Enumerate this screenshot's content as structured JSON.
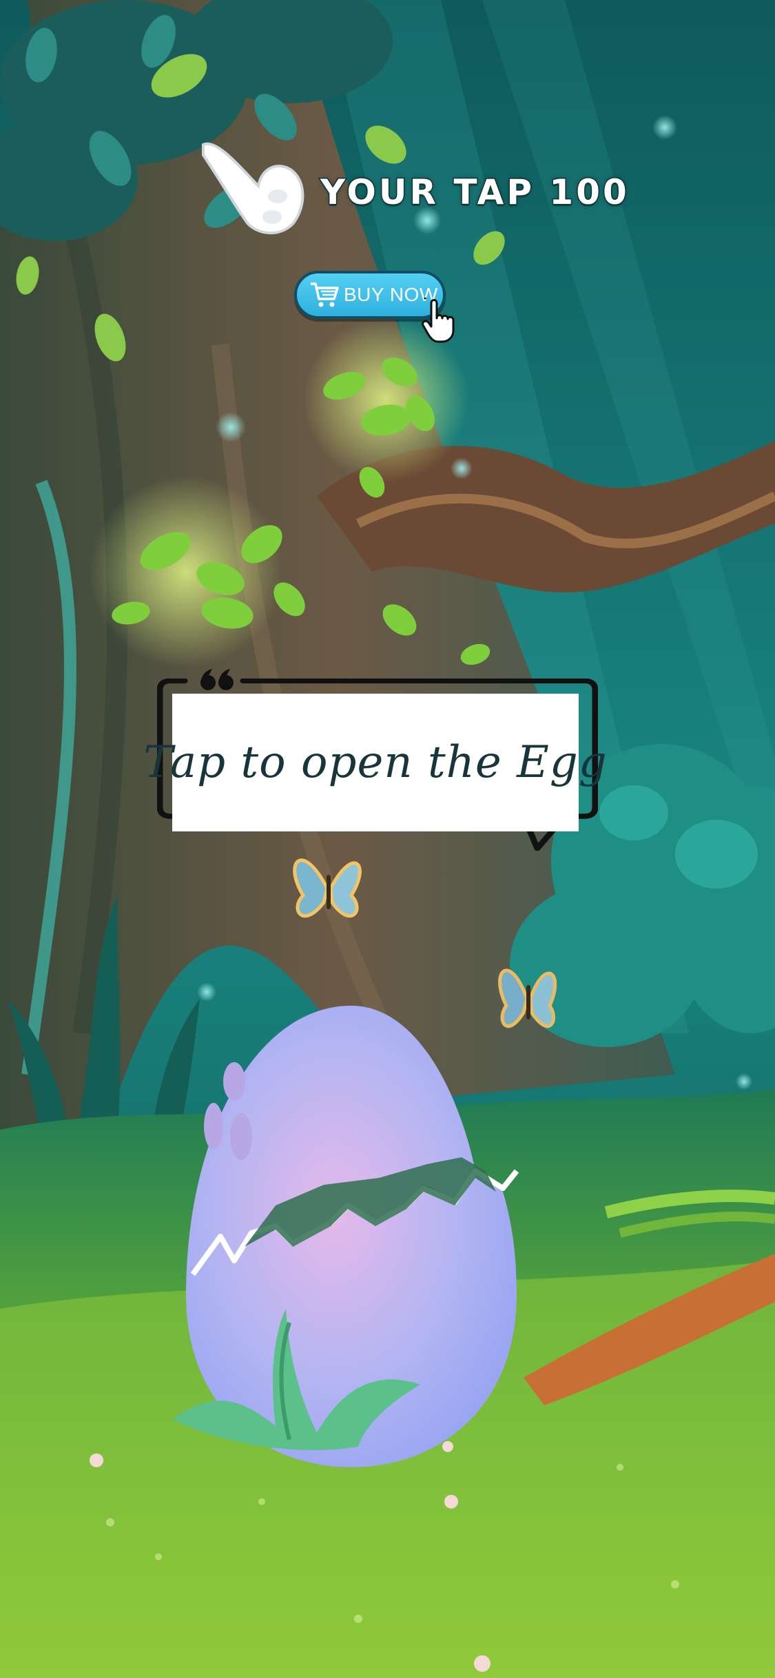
{
  "hud": {
    "tap_counter_text": "YOUR TAP 100",
    "tap_count": 100,
    "hand_icon": "pointing-hand-icon"
  },
  "buy_button": {
    "label": "BUY NOW",
    "icon": "shopping-cart-icon",
    "pointer_icon": "cursor-hand-icon",
    "color": "#3cc0ea"
  },
  "speech_bubble": {
    "text": "Tap to open the Egg",
    "icon": "quote-icon"
  },
  "egg": {
    "state": "cracked",
    "color": "#a9b2f5"
  },
  "scene": {
    "background": "enchanted-forest",
    "colors": {
      "forest": "#1d7f7a",
      "grass": "#8cc63f",
      "trunk": "#6b4b3a"
    }
  }
}
